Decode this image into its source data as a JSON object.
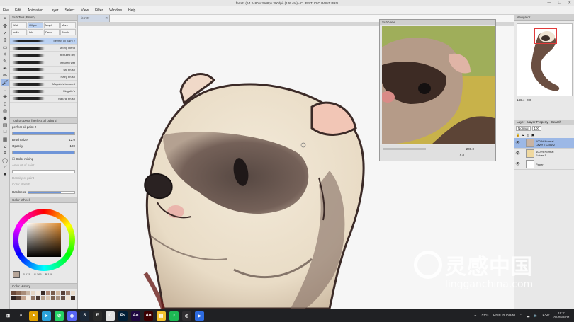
{
  "window": {
    "title": "ferret* (A4 2480 x 3508px 300dpi) (146.4%) - CLIP STUDIO PAINT PRO",
    "min": "—",
    "max": "☐",
    "close": "✕"
  },
  "menu": [
    "File",
    "Edit",
    "Animation",
    "Layer",
    "Select",
    "View",
    "Filter",
    "Window",
    "Help"
  ],
  "subtool": {
    "header": "Sub Tool [Brush]",
    "tabs": [
      "Wat",
      "Oil pa",
      "Mapl",
      "Marc",
      "India",
      "Ink",
      "Deco",
      "Brush"
    ],
    "brushes": [
      {
        "name": "perfect oil paint 2",
        "selected": true
      },
      {
        "name": "strong blend",
        "selected": false
      },
      {
        "name": "textured dry",
        "selected": false
      },
      {
        "name": "textured wet",
        "selected": false
      },
      {
        "name": "flat brush",
        "selected": false
      },
      {
        "name": "Hairy brush",
        "selected": false
      },
      {
        "name": "Magalie's textured",
        "selected": false
      },
      {
        "name": "Magalie's",
        "selected": false
      },
      {
        "name": "Natural brush",
        "selected": false
      }
    ]
  },
  "toolprop": {
    "header": "Tool property [perfect oil paint 2]",
    "brush_name": "perfect oil paint 2",
    "brush_size_label": "Brush Size",
    "brush_size_value": "12.0",
    "opacity_label": "Opacity",
    "opacity_value": "100",
    "color_mixing_label": "Color mixing",
    "amount_paint_label": "Amount of paint",
    "density_paint_label": "Density of paint",
    "color_stretch_label": "Color stretch",
    "hardness_label": "Hardness",
    "opacity_fill": 1.0,
    "size_fill": 0.4
  },
  "colorwheel": {
    "header": "Color Wheel",
    "r": "R 178",
    "g": "G 165",
    "b": "B 129"
  },
  "colorhistory": {
    "header": "Color History",
    "swatches": [
      "#6b4a3a",
      "#8c6a55",
      "#a88c78",
      "#c9b6a4",
      "#e4d6c5",
      "#f1e8dc",
      "#3a2b26",
      "#b08b77",
      "#7a5d4d",
      "#d2b9a1",
      "#574038",
      "#9e7f6c",
      "#e9dccc",
      "#2e2321",
      "#5a443a",
      "#c4a58f",
      "#f6ede2",
      "#8f7565",
      "#4b3a33",
      "#b7a08c",
      "#d9c7b4",
      "#7c6250",
      "#a7907f",
      "#665046",
      "#efe3d4",
      "#392b26"
    ]
  },
  "document": {
    "tab_label": "ferret*",
    "tab_close": "✕"
  },
  "subview": {
    "header": "Sub View",
    "zoom": "200.0",
    "angle": "0.0"
  },
  "navigator": {
    "header": "Navigator",
    "zoom": "146.4",
    "angle": "0.0"
  },
  "layers": {
    "tabs": [
      "Layer",
      "Layer Property",
      "Search"
    ],
    "blend_mode": "Normal",
    "opacity": "100",
    "items": [
      {
        "line1": "100 % Normal",
        "line2": "Layer 2 Copy 2",
        "selected": true
      },
      {
        "line1": "100 % Normal",
        "line2": "Folder 1",
        "selected": false
      },
      {
        "line1": "",
        "line2": "Paper",
        "selected": false
      }
    ]
  },
  "taskbar": {
    "weather_temp": "33°C",
    "weather_text": "Pred. nublado",
    "lang": "ESP",
    "time": "19:31",
    "date": "06/09/2021",
    "apps": [
      {
        "icon": "windows-icon",
        "color": "#202124",
        "glyph": "⊞"
      },
      {
        "icon": "search-icon",
        "color": "#202124",
        "glyph": "⌕"
      },
      {
        "icon": "chrome-icon",
        "color": "#e0a100",
        "glyph": "●"
      },
      {
        "icon": "telegram-icon",
        "color": "#2aa1da",
        "glyph": "➤"
      },
      {
        "icon": "whatsapp-icon",
        "color": "#25d366",
        "glyph": "✆"
      },
      {
        "icon": "discord-icon",
        "color": "#5865f2",
        "glyph": "◉"
      },
      {
        "icon": "steam-icon",
        "color": "#1b2838",
        "glyph": "S"
      },
      {
        "icon": "epic-icon",
        "color": "#2a2a2a",
        "glyph": "E"
      },
      {
        "icon": "clipstudio-icon",
        "color": "#e2e2e2",
        "glyph": "C"
      },
      {
        "icon": "photoshop-icon",
        "color": "#001e36",
        "glyph": "Ps"
      },
      {
        "icon": "aftereffects-icon",
        "color": "#1f0740",
        "glyph": "Ae"
      },
      {
        "icon": "animate-icon",
        "color": "#3c0000",
        "glyph": "An"
      },
      {
        "icon": "files-icon",
        "color": "#f2c12e",
        "glyph": "▤"
      },
      {
        "icon": "spotify-icon",
        "color": "#1db954",
        "glyph": "♫"
      },
      {
        "icon": "obs-icon",
        "color": "#302e31",
        "glyph": "◎"
      },
      {
        "icon": "media-icon",
        "color": "#2d6be0",
        "glyph": "▶"
      }
    ]
  },
  "watermark": {
    "title": "灵感中国",
    "subtitle": "lingganchina.com"
  },
  "colors": {
    "accent": "#9cb8e6",
    "panel": "#e8e8e8",
    "taskbar": "#202124"
  }
}
